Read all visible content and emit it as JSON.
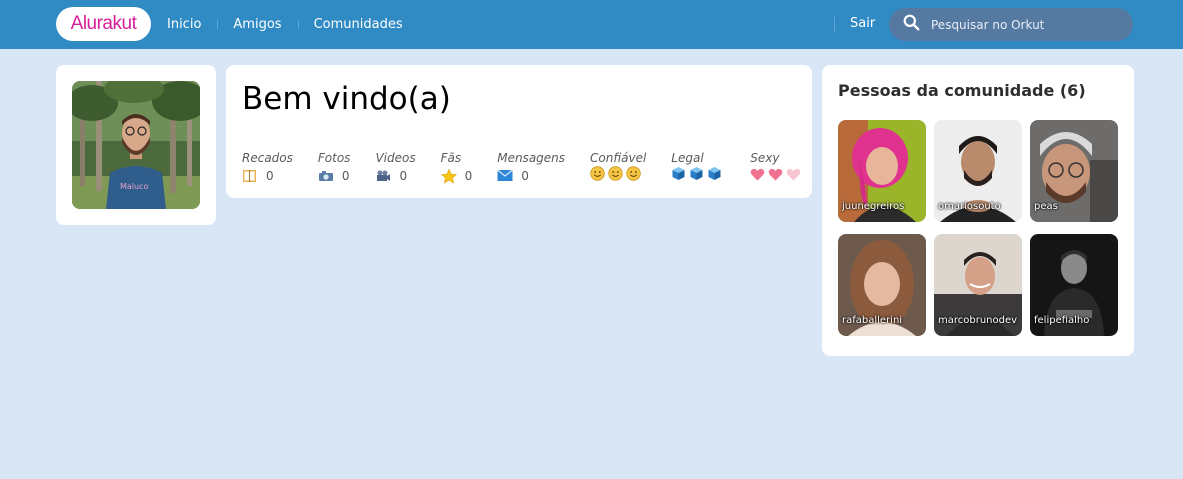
{
  "header": {
    "logo": "Alurakut",
    "nav": [
      "Inicio",
      "Amigos",
      "Comunidades"
    ],
    "logout": "Sair",
    "search": {
      "placeholder": "Pesquisar no Orkut",
      "icon": "search-icon"
    },
    "colors": {
      "bar": "#308BC5",
      "logo_text": "#D81D99",
      "search_bg": "#5579A1"
    }
  },
  "profile": {
    "avatar_alt": "profile photo"
  },
  "welcome": {
    "title": "Bem vindo(a)",
    "stats": [
      {
        "label": "Recados",
        "value": "0",
        "icon": "book-icon"
      },
      {
        "label": "Fotos",
        "value": "0",
        "icon": "camera-icon"
      },
      {
        "label": "Videos",
        "value": "0",
        "icon": "video-camera-icon"
      },
      {
        "label": "Fãs",
        "value": "0",
        "icon": "star-icon"
      },
      {
        "label": "Mensagens",
        "value": "0",
        "icon": "envelope-icon"
      }
    ],
    "ratings": [
      {
        "label": "Confiável",
        "icon": "smiley-icon",
        "level": 3,
        "max": 3
      },
      {
        "label": "Legal",
        "icon": "cube-icon",
        "level": 3,
        "max": 3
      },
      {
        "label": "Sexy",
        "icon": "heart-icon",
        "level": 2,
        "max": 3
      }
    ]
  },
  "community": {
    "title": "Pessoas da comunidade (6)",
    "people": [
      {
        "name": "juunegreiros"
      },
      {
        "name": "omariosouto"
      },
      {
        "name": "peas"
      },
      {
        "name": "rafaballerini"
      },
      {
        "name": "marcobrunodev"
      },
      {
        "name": "felipefialho"
      }
    ]
  },
  "colors": {
    "page_bg": "#D9E6F6",
    "card_bg": "#FFFFFF"
  }
}
